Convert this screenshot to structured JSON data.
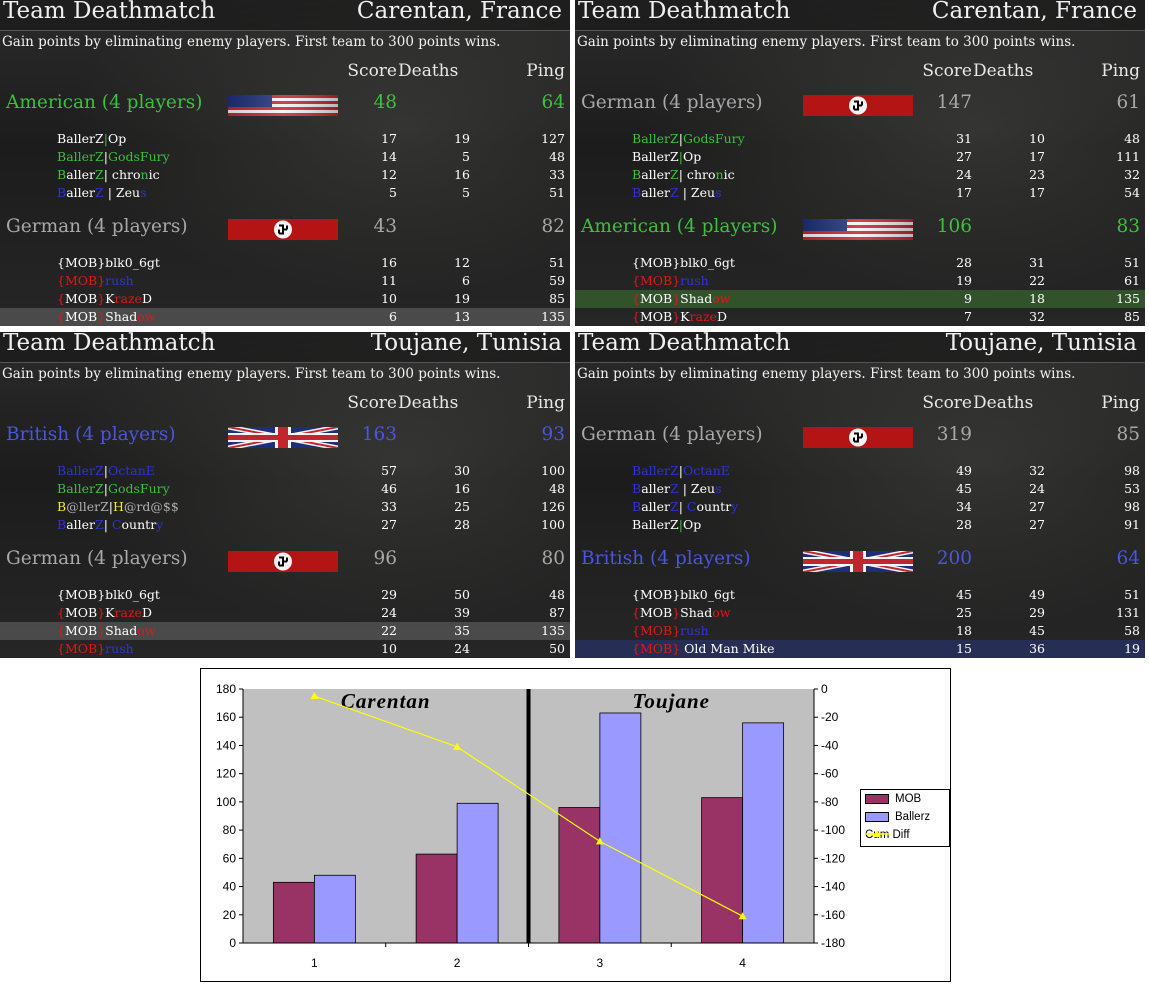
{
  "colors": {
    "american": "#3fbf3f",
    "german": "#a8a8a8",
    "british": "#4a55e0",
    "mob_bar": "#993366",
    "ballerz_bar": "#9999ff",
    "cum_diff_line": "#ffff00",
    "plot_bg": "#c0c0c0"
  },
  "panels": [
    {
      "mode": "Team Deathmatch",
      "map": "Carentan, France",
      "description": "Gain points by eliminating enemy players. First team to 300 points wins.",
      "col_score": "Score",
      "col_deaths": "Deaths",
      "col_ping": "Ping",
      "teams": [
        {
          "name": "American (4 players)",
          "flag": "us-flag",
          "score": "48",
          "ping": "64",
          "players": [
            {
              "name": "BallerZ|Op",
              "score": "17",
              "deaths": "19",
              "ping": "127"
            },
            {
              "name": "BallerZ|GodsFury",
              "score": "14",
              "deaths": "5",
              "ping": "48"
            },
            {
              "name": "BallerZ| chronic",
              "score": "12",
              "deaths": "16",
              "ping": "33"
            },
            {
              "name": "BallerZ | Zeus",
              "score": "5",
              "deaths": "5",
              "ping": "51"
            }
          ]
        },
        {
          "name": "German (4 players)",
          "flag": "german-flag",
          "score": "43",
          "ping": "82",
          "players": [
            {
              "name": "{MOB}blk0_6gt",
              "score": "16",
              "deaths": "12",
              "ping": "51"
            },
            {
              "name": "{MOB}rush",
              "score": "11",
              "deaths": "6",
              "ping": "59"
            },
            {
              "name": "{MOB}KrazeD",
              "score": "10",
              "deaths": "19",
              "ping": "85"
            },
            {
              "name": "{MOB}Shadow",
              "score": "6",
              "deaths": "13",
              "ping": "135"
            }
          ]
        }
      ]
    },
    {
      "mode": "Team Deathmatch",
      "map": "Carentan, France",
      "description": "Gain points by eliminating enemy players. First team to 300 points wins.",
      "col_score": "Score",
      "col_deaths": "Deaths",
      "col_ping": "Ping",
      "teams": [
        {
          "name": "German (4 players)",
          "flag": "german-flag",
          "score": "147",
          "ping": "61",
          "players": [
            {
              "name": "BallerZ|GodsFury",
              "score": "31",
              "deaths": "10",
              "ping": "48"
            },
            {
              "name": "BallerZ|Op",
              "score": "27",
              "deaths": "17",
              "ping": "111"
            },
            {
              "name": "BallerZ| chronic",
              "score": "24",
              "deaths": "23",
              "ping": "32"
            },
            {
              "name": "BallerZ | Zeus",
              "score": "17",
              "deaths": "17",
              "ping": "54"
            }
          ]
        },
        {
          "name": "American (4 players)",
          "flag": "us-flag",
          "score": "106",
          "ping": "83",
          "players": [
            {
              "name": "{MOB}blk0_6gt",
              "score": "28",
              "deaths": "31",
              "ping": "51"
            },
            {
              "name": "{MOB}rush",
              "score": "19",
              "deaths": "22",
              "ping": "61"
            },
            {
              "name": "{MOB}Shadow",
              "score": "9",
              "deaths": "18",
              "ping": "135"
            },
            {
              "name": "{MOB}KrazeD",
              "score": "7",
              "deaths": "32",
              "ping": "85"
            }
          ]
        }
      ]
    },
    {
      "mode": "Team Deathmatch",
      "map": "Toujane, Tunisia",
      "description": "Gain points by eliminating enemy players. First team to 300 points wins.",
      "col_score": "Score",
      "col_deaths": "Deaths",
      "col_ping": "Ping",
      "teams": [
        {
          "name": "British (4 players)",
          "flag": "uk-flag",
          "score": "163",
          "ping": "93",
          "players": [
            {
              "name": "BallerZ|OctanE",
              "score": "57",
              "deaths": "30",
              "ping": "100"
            },
            {
              "name": "BallerZ|GodsFury",
              "score": "46",
              "deaths": "16",
              "ping": "48"
            },
            {
              "name": "B@llerZ|H@rd@$$",
              "score": "33",
              "deaths": "25",
              "ping": "126"
            },
            {
              "name": "BallerZ| Country",
              "score": "27",
              "deaths": "28",
              "ping": "100"
            }
          ]
        },
        {
          "name": "German (4 players)",
          "flag": "german-flag",
          "score": "96",
          "ping": "80",
          "players": [
            {
              "name": "{MOB}blk0_6gt",
              "score": "29",
              "deaths": "50",
              "ping": "48"
            },
            {
              "name": "{MOB}KrazeD",
              "score": "24",
              "deaths": "39",
              "ping": "87"
            },
            {
              "name": "{MOB}Shadow",
              "score": "22",
              "deaths": "35",
              "ping": "135"
            },
            {
              "name": "{MOB}rush",
              "score": "10",
              "deaths": "24",
              "ping": "50"
            }
          ]
        }
      ]
    },
    {
      "mode": "Team Deathmatch",
      "map": "Toujane, Tunisia",
      "description": "Gain points by eliminating enemy players. First team to 300 points wins.",
      "col_score": "Score",
      "col_deaths": "Deaths",
      "col_ping": "Ping",
      "teams": [
        {
          "name": "German (4 players)",
          "flag": "german-flag",
          "score": "319",
          "ping": "85",
          "players": [
            {
              "name": "BallerZ|OctanE",
              "score": "49",
              "deaths": "32",
              "ping": "98"
            },
            {
              "name": "BallerZ | Zeus",
              "score": "45",
              "deaths": "24",
              "ping": "53"
            },
            {
              "name": "BallerZ| Country",
              "score": "34",
              "deaths": "27",
              "ping": "98"
            },
            {
              "name": "BallerZ|Op",
              "score": "28",
              "deaths": "27",
              "ping": "91"
            }
          ]
        },
        {
          "name": "British (4 players)",
          "flag": "uk-flag",
          "score": "200",
          "ping": "64",
          "players": [
            {
              "name": "{MOB}blk0_6gt",
              "score": "45",
              "deaths": "49",
              "ping": "51"
            },
            {
              "name": "{MOB}Shadow",
              "score": "25",
              "deaths": "29",
              "ping": "131"
            },
            {
              "name": "{MOB}rush",
              "score": "18",
              "deaths": "45",
              "ping": "58"
            },
            {
              "name": "{MOB} Old Man Mike",
              "score": "15",
              "deaths": "36",
              "ping": "19"
            }
          ]
        }
      ]
    }
  ],
  "chart_data": {
    "type": "bar",
    "categories": [
      "1",
      "2",
      "3",
      "4"
    ],
    "series": [
      {
        "name": "MOB",
        "type": "bar",
        "axis": "left",
        "values": [
          43,
          63,
          96,
          103
        ]
      },
      {
        "name": "Ballerz",
        "type": "bar",
        "axis": "left",
        "values": [
          48,
          99,
          163,
          156
        ]
      },
      {
        "name": "Cum Diff",
        "type": "line",
        "axis": "right",
        "values": [
          -5,
          -41,
          -108,
          -161
        ]
      }
    ],
    "ylim": [
      0,
      180
    ],
    "y2lim": [
      -180,
      0
    ],
    "yticks": [
      "180",
      "160",
      "140",
      "120",
      "100",
      "80",
      "60",
      "40",
      "20",
      "0"
    ],
    "y2ticks": [
      "0",
      "-20",
      "-40",
      "-60",
      "-80",
      "-100",
      "-120",
      "-140",
      "-160",
      "-180"
    ],
    "region_labels": [
      "Carentan",
      "Toujane"
    ],
    "legend_position": "right",
    "grid": false
  }
}
